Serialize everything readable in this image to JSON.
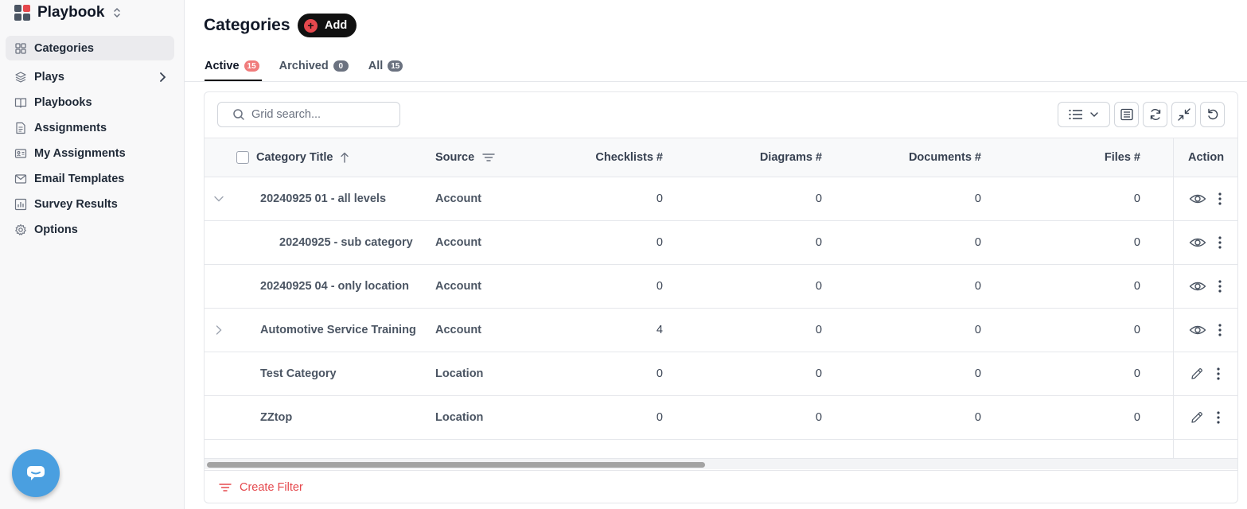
{
  "app": {
    "name": "Playbook"
  },
  "sidebar": {
    "items": [
      {
        "label": "Categories",
        "icon": "grid-icon",
        "active": true
      },
      {
        "label": "Plays",
        "icon": "layers-icon",
        "has_submenu": true
      },
      {
        "label": "Playbooks",
        "icon": "book-open-icon"
      },
      {
        "label": "Assignments",
        "icon": "document-icon"
      },
      {
        "label": "My Assignments",
        "icon": "id-card-icon"
      },
      {
        "label": "Email Templates",
        "icon": "mail-icon"
      },
      {
        "label": "Survey Results",
        "icon": "bar-chart-icon"
      },
      {
        "label": "Options",
        "icon": "gear-icon"
      }
    ]
  },
  "header": {
    "title": "Categories",
    "add_label": "Add"
  },
  "tabs": [
    {
      "label": "Active",
      "count": "15",
      "active": true
    },
    {
      "label": "Archived",
      "count": "0"
    },
    {
      "label": "All",
      "count": "15"
    }
  ],
  "grid": {
    "search_placeholder": "Grid search...",
    "columns": {
      "title": "Category Title",
      "source": "Source",
      "checklists": "Checklists #",
      "diagrams": "Diagrams #",
      "documents": "Documents #",
      "files": "Files #",
      "action": "Action"
    },
    "rows": [
      {
        "title": "20240925 01 - all levels",
        "source": "Account",
        "checklists": "0",
        "diagrams": "0",
        "documents": "0",
        "files": "0",
        "expander": "expanded",
        "indent": 0,
        "action": "view"
      },
      {
        "title": "20240925 - sub category",
        "source": "Account",
        "checklists": "0",
        "diagrams": "0",
        "documents": "0",
        "files": "0",
        "expander": "none",
        "indent": 1,
        "action": "view"
      },
      {
        "title": "20240925 04 - only location",
        "source": "Account",
        "checklists": "0",
        "diagrams": "0",
        "documents": "0",
        "files": "0",
        "expander": "none",
        "indent": 0,
        "action": "view"
      },
      {
        "title": "Automotive Service Training",
        "source": "Account",
        "checklists": "4",
        "diagrams": "0",
        "documents": "0",
        "files": "0",
        "expander": "collapsed",
        "indent": 0,
        "action": "view"
      },
      {
        "title": "Test Category",
        "source": "Location",
        "checklists": "0",
        "diagrams": "0",
        "documents": "0",
        "files": "0",
        "expander": "none",
        "indent": 0,
        "action": "edit"
      },
      {
        "title": "ZZtop",
        "source": "Location",
        "checklists": "0",
        "diagrams": "0",
        "documents": "0",
        "files": "0",
        "expander": "none",
        "indent": 0,
        "action": "edit"
      }
    ],
    "footer_label": "Create Filter"
  },
  "colors": {
    "accent": "#e5484d",
    "chat": "#4a9fe0",
    "sidebar_bg": "#f8f8f9"
  }
}
